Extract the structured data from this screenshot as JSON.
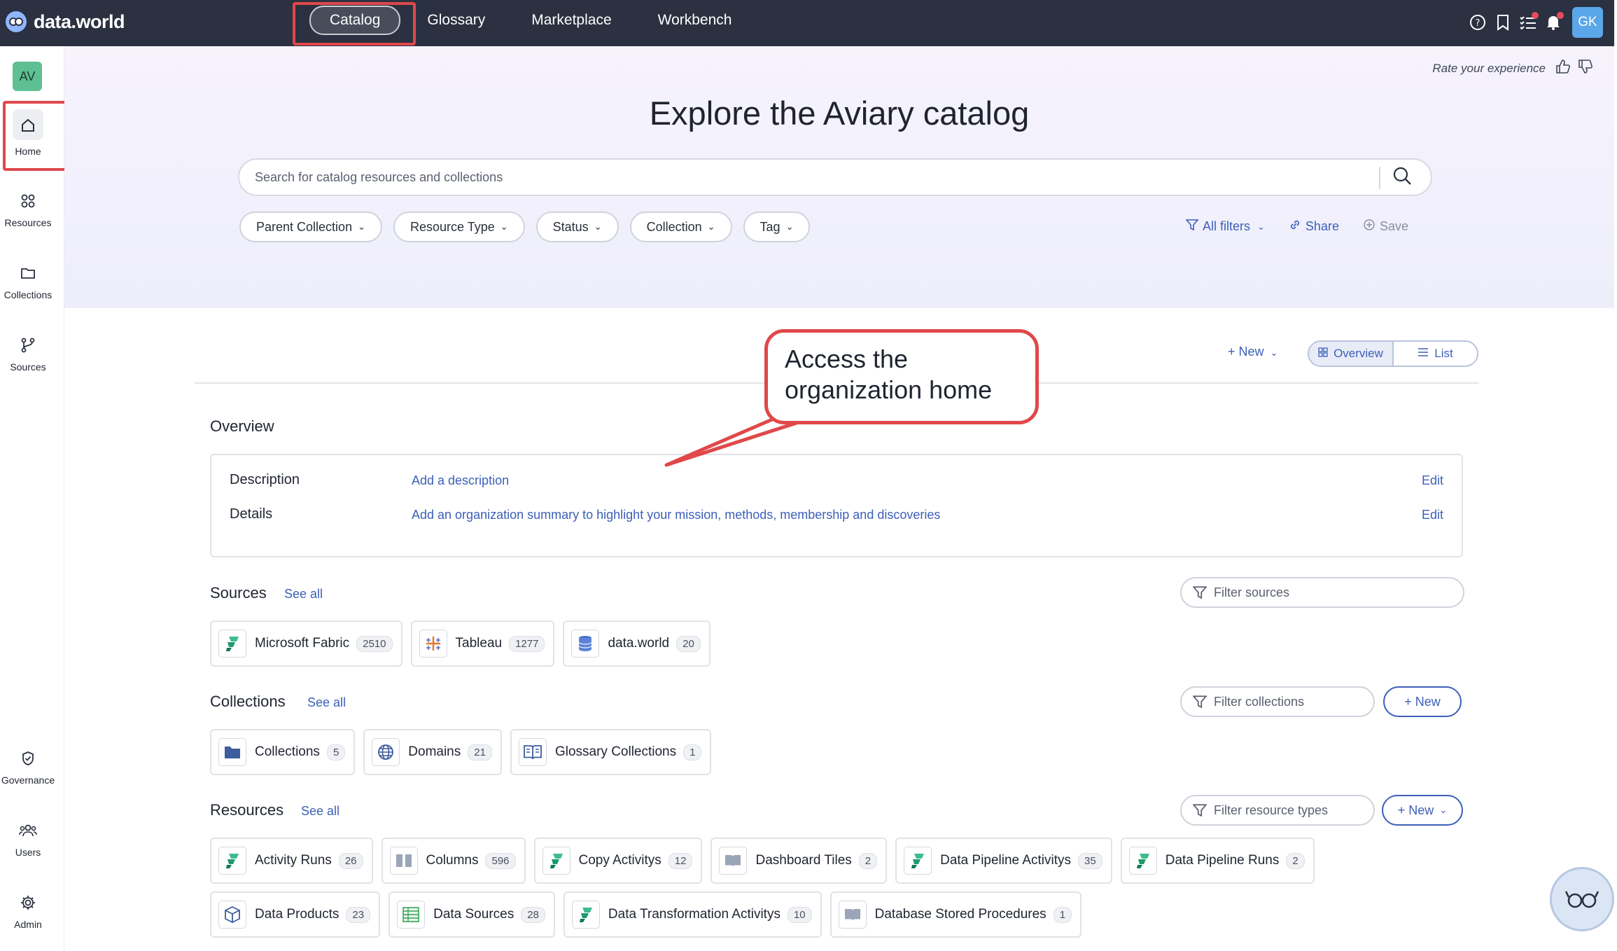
{
  "app": {
    "logo_text": "data.world",
    "nav": [
      {
        "label": "Catalog",
        "active": true
      },
      {
        "label": "Glossary"
      },
      {
        "label": "Marketplace"
      },
      {
        "label": "Workbench"
      }
    ],
    "user_initials": "GK"
  },
  "sidebar": {
    "org_initials": "AV",
    "items": [
      {
        "label": "Home",
        "icon": "home-icon"
      },
      {
        "label": "Resources",
        "icon": "grid-icon"
      },
      {
        "label": "Collections",
        "icon": "folder-icon"
      },
      {
        "label": "Sources",
        "icon": "branch-icon"
      },
      {
        "label": "Governance",
        "icon": "shield-icon"
      },
      {
        "label": "Users",
        "icon": "users-icon"
      },
      {
        "label": "Admin",
        "icon": "gear-icon"
      }
    ]
  },
  "hero": {
    "rate_text": "Rate your experience",
    "title": "Explore the Aviary catalog",
    "search_placeholder": "Search for catalog resources and collections",
    "filters": [
      "Parent Collection",
      "Resource Type",
      "Status",
      "Collection",
      "Tag"
    ],
    "actions": {
      "all_filters": "All filters",
      "share": "Share",
      "save": "Save"
    }
  },
  "toolbar": {
    "new_label": "+ New",
    "view_overview": "Overview",
    "view_list": "List"
  },
  "overview": {
    "title": "Overview",
    "description_label": "Description",
    "description_link": "Add a description",
    "details_label": "Details",
    "details_link": "Add an organization summary to highlight your mission, methods, membership and discoveries",
    "edit_label": "Edit"
  },
  "sources": {
    "title": "Sources",
    "see_all": "See all",
    "filter_placeholder": "Filter sources",
    "items": [
      {
        "label": "Microsoft Fabric",
        "count": "2510"
      },
      {
        "label": "Tableau",
        "count": "1277"
      },
      {
        "label": "data.world",
        "count": "20"
      }
    ]
  },
  "collections": {
    "title": "Collections",
    "see_all": "See all",
    "filter_placeholder": "Filter collections",
    "new_label": "+ New",
    "items": [
      {
        "label": "Collections",
        "count": "5"
      },
      {
        "label": "Domains",
        "count": "21"
      },
      {
        "label": "Glossary Collections",
        "count": "1"
      }
    ]
  },
  "resources": {
    "title": "Resources",
    "see_all": "See all",
    "filter_placeholder": "Filter resource types",
    "new_label": "+ New",
    "row1": [
      {
        "label": "Activity Runs",
        "count": "26"
      },
      {
        "label": "Columns",
        "count": "596"
      },
      {
        "label": "Copy Activitys",
        "count": "12"
      },
      {
        "label": "Dashboard Tiles",
        "count": "2"
      },
      {
        "label": "Data Pipeline Activitys",
        "count": "35"
      },
      {
        "label": "Data Pipeline Runs",
        "count": "2"
      }
    ],
    "row2": [
      {
        "label": "Data Products",
        "count": "23"
      },
      {
        "label": "Data Sources",
        "count": "28"
      },
      {
        "label": "Data Transformation Activitys",
        "count": "10"
      },
      {
        "label": "Database Stored Procedures",
        "count": "1"
      }
    ]
  },
  "callout": {
    "line1": "Access the",
    "line2": "organization home"
  },
  "colors": {
    "topbar": "#2b3140",
    "accent": "#3c5fb8",
    "highlight": "#e0484a"
  }
}
